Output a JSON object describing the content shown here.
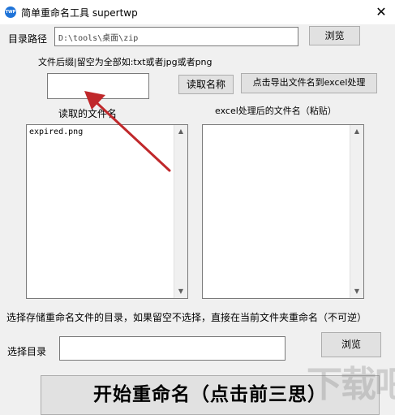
{
  "window": {
    "title": "简单重命名工具 supertwp",
    "icon_text": "TWP",
    "close_glyph": "✕"
  },
  "dir_row": {
    "label": "目录路径",
    "value": "D:\\tools\\桌面\\zip",
    "browse_label": "浏览"
  },
  "suffix": {
    "hint": "文件后缀|留空为全部如:txt或者jpg或者png",
    "value": "",
    "read_names_label": "读取名称",
    "export_label": "点击导出文件名到excel处理"
  },
  "lists": {
    "left_title": "读取的文件名",
    "left_items": [
      "expired.png"
    ],
    "right_title": "excel处理后的文件名（粘贴）",
    "right_items": []
  },
  "target": {
    "hint": "选择存储重命名文件的目录，如果留空不选择，直接在当前文件夹重命名（不可逆）",
    "label": "选择目录",
    "value": "",
    "browse_label": "浏览"
  },
  "start_button_label": "开始重命名（点击前三思）",
  "watermark": "下载吧",
  "colors": {
    "arrow": "#c0282b",
    "icon": "#1e73d8"
  }
}
